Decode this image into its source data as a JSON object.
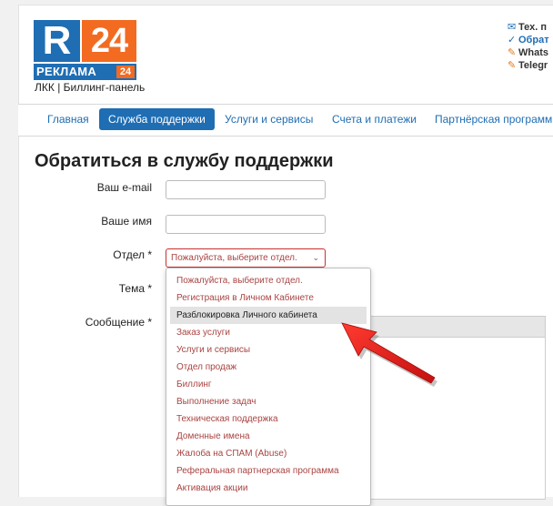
{
  "logo": {
    "letter": "R",
    "number": "24",
    "word": "РЕКЛАМА",
    "small_number": "24",
    "subtitle": "ЛКК | Биллинг-панель"
  },
  "contacts": [
    {
      "icon": "envelope-icon",
      "text": "Тех. п"
    },
    {
      "icon": "check-icon",
      "text": "Обрат"
    },
    {
      "icon": "whatsapp-icon",
      "text": "Whats"
    },
    {
      "icon": "telegram-icon",
      "text": "Telegr"
    }
  ],
  "nav": {
    "items": [
      {
        "label": "Главная",
        "active": false
      },
      {
        "label": "Служба поддержки",
        "active": true
      },
      {
        "label": "Услуги и сервисы",
        "active": false
      },
      {
        "label": "Счета и платежи",
        "active": false
      },
      {
        "label": "Партнёрская программ",
        "active": false
      }
    ]
  },
  "form": {
    "title": "Обратиться в службу поддержки",
    "email_label": "Ваш e-mail",
    "name_label": "Ваше имя",
    "dept_label": "Отдел *",
    "subject_label": "Тема *",
    "message_label": "Сообщение *",
    "dept_selected": "Пожалуйста, выберите отдел.",
    "dept_options": [
      "Пожалуйста, выберите отдел.",
      "Регистрация в Личном Кабинете",
      "Разблокировка Личного кабинета",
      "Заказ услуги",
      "Услуги и сервисы",
      "Отдел продаж",
      "Биллинг",
      "Выполнение задач",
      "Техническая поддержка",
      "Доменные имена",
      "Жалоба на СПАМ (Abuse)",
      "Реферальная партнерская программа",
      "Активация акции"
    ],
    "highlighted_option": "Разблокировка Личного кабинета"
  },
  "colors": {
    "brand_blue": "#1f6db3",
    "brand_orange": "#f26b21",
    "error_red": "#a94442",
    "arrow_red": "#e62020"
  }
}
